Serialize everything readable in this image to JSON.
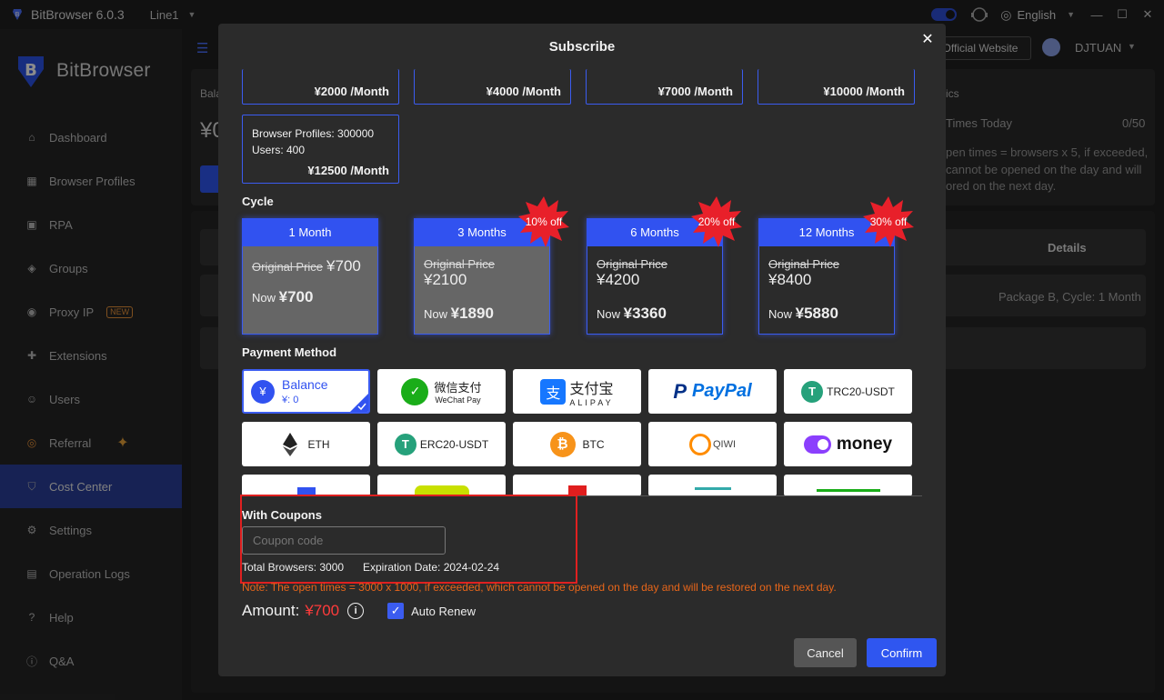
{
  "app": {
    "title": "BitBrowser 6.0.3",
    "line": "Line1",
    "language": "English",
    "brand": "BitBrowser"
  },
  "header": {
    "official_website": "Official Website",
    "user": "DJTUAN"
  },
  "sidebar": {
    "items": [
      {
        "label": "Dashboard",
        "icon": "home-icon"
      },
      {
        "label": "Browser Profiles",
        "icon": "grid-icon"
      },
      {
        "label": "RPA",
        "icon": "robot-icon"
      },
      {
        "label": "Groups",
        "icon": "layers-icon"
      },
      {
        "label": "Proxy IP",
        "icon": "location-icon",
        "badge": "NEW"
      },
      {
        "label": "Extensions",
        "icon": "puzzle-icon"
      },
      {
        "label": "Users",
        "icon": "users-icon"
      },
      {
        "label": "Referral",
        "icon": "referral-icon"
      },
      {
        "label": "Cost Center",
        "icon": "shield-icon"
      },
      {
        "label": "Settings",
        "icon": "gear-icon"
      },
      {
        "label": "Operation Logs",
        "icon": "log-icon"
      },
      {
        "label": "Help",
        "icon": "help-icon"
      },
      {
        "label": "Q&A",
        "icon": "info-icon"
      }
    ]
  },
  "background": {
    "balance_label": "Bala",
    "balance_value": "¥0",
    "stats_label": "ics",
    "times_today": "Times Today",
    "times_count": "0/50",
    "open_note_1": "pen times = browsers x 5, if exceeded,",
    "open_note_2": "cannot be opened on the day and will",
    "open_note_3": "ored on the next day.",
    "details_header": "Details",
    "details_row": "Package B, Cycle: 1 Month"
  },
  "modal": {
    "title": "Subscribe",
    "packages": [
      {
        "price": "¥2000 /Month"
      },
      {
        "price": "¥4000 /Month"
      },
      {
        "price": "¥7000 /Month"
      },
      {
        "price": "¥10000 /Month"
      }
    ],
    "package_last": {
      "profiles": "Browser Profiles: 300000",
      "users": "Users: 400",
      "price": "¥12500 /Month"
    },
    "cycle_label": "Cycle",
    "cycles": [
      {
        "label": "1 Month",
        "orig_label": "Original Price",
        "orig_value": "¥700",
        "now_label": "Now",
        "now_value": "¥700"
      },
      {
        "label": "3 Months",
        "orig_label": "Original Price",
        "orig_value": "¥2100",
        "now_label": "Now",
        "now_value": "¥1890",
        "discount": "10% off"
      },
      {
        "label": "6 Months",
        "orig_label": "Original Price",
        "orig_value": "¥4200",
        "now_label": "Now",
        "now_value": "¥3360",
        "discount": "20% off"
      },
      {
        "label": "12 Months",
        "orig_label": "Original Price",
        "orig_value": "¥8400",
        "now_label": "Now",
        "now_value": "¥5880",
        "discount": "30% off"
      }
    ],
    "payment_label": "Payment Method",
    "balance_pay": {
      "label": "Balance",
      "amount": "¥: 0"
    },
    "payments": {
      "wechat_cn": "微信支付",
      "wechat_en": "WeChat Pay",
      "alipay_cn": "支付宝",
      "alipay_en": "ALIPAY",
      "paypal": "PayPal",
      "trc20": "TRC20-USDT",
      "eth": "ETH",
      "erc20": "ERC20-USDT",
      "btc": "BTC",
      "qiwi": "QIWI",
      "money": "money"
    },
    "coupon_label": "With Coupons",
    "coupon_placeholder": "Coupon code",
    "total_browsers": "Total Browsers: 3000",
    "expiration": "Expiration Date: 2024-02-24",
    "note": "Note: The open times = 3000 x 1000, if exceeded, which cannot be opened on the day and will be restored on the next day.",
    "amount_label": "Amount:",
    "amount_value": "¥700",
    "auto_renew": "Auto Renew",
    "cancel": "Cancel",
    "confirm": "Confirm"
  },
  "colors": {
    "accent": "#3152f0",
    "warning": "#e8661a",
    "price_red": "#ff3b3b",
    "coupon_border": "#e02020"
  }
}
